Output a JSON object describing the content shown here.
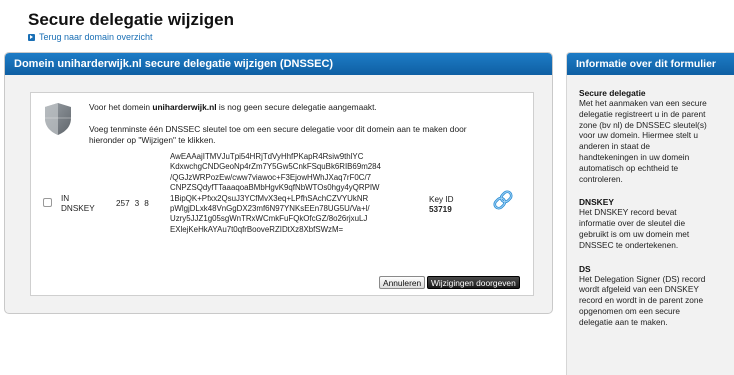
{
  "header": {
    "title": "Secure delegatie wijzigen",
    "back_link": "Terug naar domain overzicht"
  },
  "main": {
    "panel_title": "Domein uniharderwijk.nl secure delegatie wijzigen (DNSSEC)",
    "notice_prefix": "Voor het domein ",
    "notice_domain": "uniharderwijk.nl",
    "notice_suffix": " is nog geen secure delegatie aangemaakt.",
    "instruction": "Voeg tenminste één DNSSEC sleutel toe om een secure delegatie voor dit domein aan te maken door hieronder op \"Wijzigen\" te klikken.",
    "key": {
      "class": "IN",
      "type": "DNSKEY",
      "flags": "257",
      "protocol": "3",
      "algorithm": "8",
      "public_key_lines": [
        "AwEAAajITMVJuTpi54HRjTdVyHhfPKapR4Rsiw9thlYC",
        "KdxwchgCNDGeoNp4rZm7Y5Gw5CnkFSquBk6RIB69m284",
        "/QGJzWRPozEw/cww7viawoc+F3EjowHWhJXaq7rF0C/7",
        "CNPZSQdyfTTaaaqoaBMbHgvK9qfNbWTOs0hgy4yQRPIW",
        "1BipQK+Pfxx2QsuJ3YCfMvX3eq+LPfhSAchCZVYUkNR",
        "pWlgjDLxk48VnGgDX23mf6N97YNKsEEn78UG5U/Va+l/",
        "Uzry5JJZ1g05sgWnTRxWCmkFuFQkOfcGZ/8o26rjxuLJ",
        "EXlejKeHkAYAu7t0qfrBooveRZIDtXz8XbfSWzM="
      ],
      "keyid_label": "Key ID",
      "keyid_value": "53719"
    },
    "buttons": {
      "cancel": "Annuleren",
      "submit": "Wijzigingen doorgeven"
    }
  },
  "sidebar": {
    "title": "Informatie over dit formulier",
    "sections": [
      {
        "heading": "Secure delegatie",
        "text": "Met het aanmaken van een secure delegatie registreert u in de parent zone (bv nl) de DNSSEC sleutel(s) voor uw domein. Hiermee stelt u anderen in staat de handtekeningen in uw domein automatisch op echtheid te controleren."
      },
      {
        "heading": "DNSKEY",
        "text": "Het DNSKEY record bevat informatie over de sleutel die gebruikt is om uw domein met DNSSEC te ondertekenen."
      },
      {
        "heading": "DS",
        "text": "Het Delegation Signer (DS) record wordt afgeleid van een DNSKEY record en wordt in de parent zone opgenomen om een secure delegatie aan te maken."
      }
    ]
  },
  "colors": {
    "header_blue": "#1668b0",
    "link_blue": "#1a6fb5",
    "panel_bg": "#f2f2f2"
  },
  "icons": [
    "shield-icon",
    "link-icon",
    "arrow-bullet-icon"
  ]
}
